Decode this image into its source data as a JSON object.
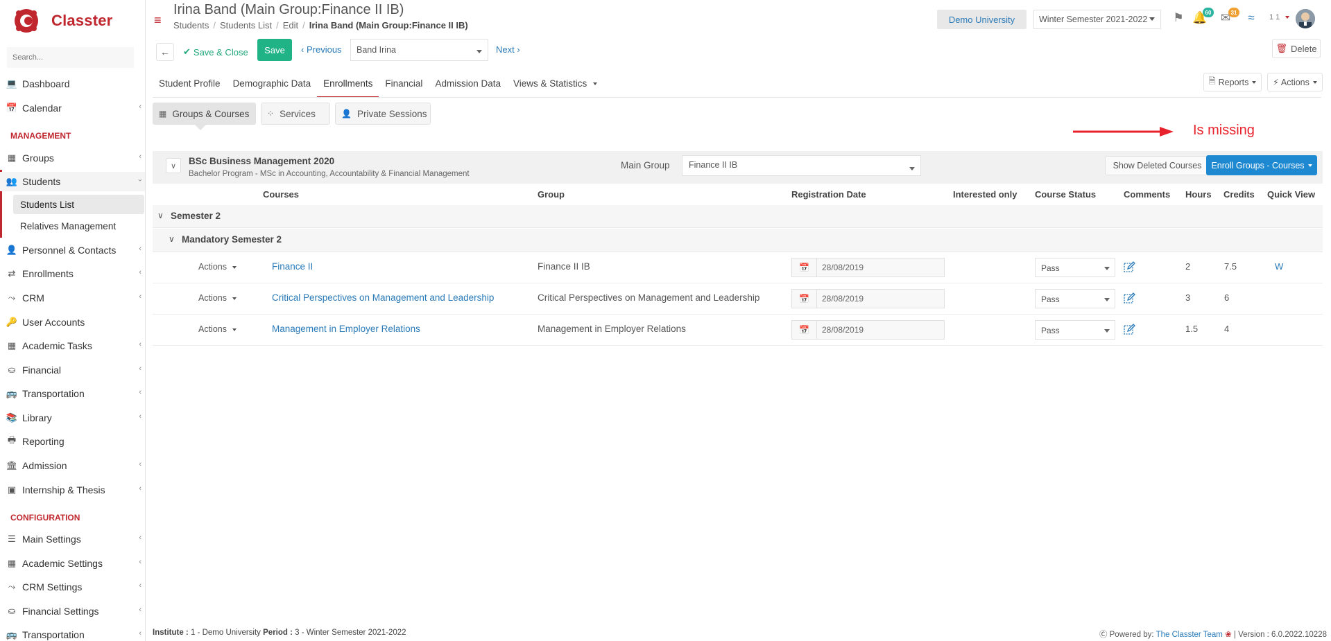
{
  "app": {
    "name": "Classter"
  },
  "colors": {
    "brand": "#c0262d",
    "link": "#2a7ab8",
    "primary": "#1e88d1",
    "success": "#1fb385",
    "annotation": "#e8222c"
  },
  "sidebar": {
    "search_placeholder": "Search...",
    "sections": {
      "management": "MANAGEMENT",
      "configuration": "CONFIGURATION"
    },
    "items": [
      {
        "label": "Dashboard",
        "icon": "laptop-icon"
      },
      {
        "label": "Calendar",
        "icon": "calendar-icon"
      },
      {
        "label": "Groups",
        "icon": "groups-icon"
      },
      {
        "label": "Students",
        "icon": "students-icon"
      },
      {
        "label": "Students List"
      },
      {
        "label": "Relatives Management"
      },
      {
        "label": "Personnel & Contacts",
        "icon": "person-icon"
      },
      {
        "label": "Enrollments",
        "icon": "exchange-icon"
      },
      {
        "label": "CRM",
        "icon": "crm-icon"
      },
      {
        "label": "User Accounts",
        "icon": "key-icon"
      },
      {
        "label": "Academic Tasks",
        "icon": "tasks-icon"
      },
      {
        "label": "Financial",
        "icon": "coins-icon"
      },
      {
        "label": "Transportation",
        "icon": "bus-icon"
      },
      {
        "label": "Library",
        "icon": "books-icon"
      },
      {
        "label": "Reporting",
        "icon": "printer-icon"
      },
      {
        "label": "Admission",
        "icon": "bank-icon"
      },
      {
        "label": "Internship & Thesis",
        "icon": "box-icon"
      },
      {
        "label": "Main Settings",
        "icon": "sliders-icon"
      },
      {
        "label": "Academic Settings",
        "icon": "groups-icon"
      },
      {
        "label": "CRM Settings",
        "icon": "crm-icon"
      },
      {
        "label": "Financial Settings",
        "icon": "coins-icon"
      },
      {
        "label": "Transportation",
        "icon": "bus-icon"
      }
    ]
  },
  "header": {
    "title": "Irina Band (Main Group:Finance II IB)",
    "breadcrumb": [
      "Students",
      "Students List",
      "Edit",
      "Irina Band (Main Group:Finance II IB)"
    ],
    "university": "Demo University",
    "semester": "Winter Semester 2021-2022",
    "notifications_count": "60",
    "messages_count": "31",
    "user_label": "1 1"
  },
  "toolbar": {
    "save_close": "Save & Close",
    "save": "Save",
    "previous": "Previous",
    "student": "Band Irina",
    "next": "Next",
    "delete": "Delete"
  },
  "tabs": [
    "Student Profile",
    "Demographic Data",
    "Enrollments",
    "Financial",
    "Admission Data",
    "Views & Statistics"
  ],
  "tab_buttons": {
    "reports": "Reports",
    "actions": "Actions"
  },
  "subtabs": [
    "Groups & Courses",
    "Services",
    "Private Sessions"
  ],
  "annotation": "Is missing",
  "program": {
    "title": "BSc Business Management 2020",
    "subtitle": "Bachelor Program - MSc in Accounting, Accountability & Financial Management",
    "main_group_label": "Main Group",
    "main_group": "Finance II IB",
    "show_deleted": "Show Deleted Courses",
    "enroll": "Enroll Groups - Courses"
  },
  "table": {
    "columns": [
      "Courses",
      "Group",
      "Registration Date",
      "Interested only",
      "Course Status",
      "Comments",
      "Hours",
      "Credits",
      "Quick View"
    ],
    "semester": "Semester 2",
    "subgroup": "Mandatory Semester 2",
    "rows": [
      {
        "actions": "Actions",
        "course": "Finance II",
        "group": "Finance II IB",
        "date": "28/08/2019",
        "status": "Pass",
        "hours": "2",
        "credits": "7.5",
        "quick_view": "W"
      },
      {
        "actions": "Actions",
        "course": "Critical Perspectives on Management and Leadership",
        "group": "Critical Perspectives on Management and Leadership",
        "date": "28/08/2019",
        "status": "Pass",
        "hours": "3",
        "credits": "6",
        "quick_view": ""
      },
      {
        "actions": "Actions",
        "course": "Management in Employer Relations",
        "group": "Management in Employer Relations",
        "date": "28/08/2019",
        "status": "Pass",
        "hours": "1.5",
        "credits": "4",
        "quick_view": ""
      }
    ]
  },
  "footer": {
    "institute_label": "Institute :",
    "institute": "1 - Demo University",
    "period_label": "Period :",
    "period": "3 - Winter Semester 2021-2022",
    "powered_by": "Powered by:",
    "team": "The Classter Team",
    "version": "| Version : 6.0.2022.10228"
  }
}
